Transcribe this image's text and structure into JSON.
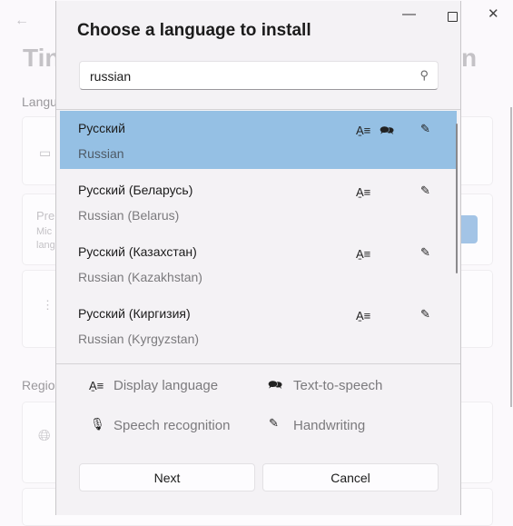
{
  "background": {
    "title_fragment_left": "Tin",
    "title_fragment_right": "n",
    "section_language_fragment": "Langu",
    "preferred_fragment_1": "Pre",
    "preferred_fragment_2": "Mic",
    "preferred_fragment_3": "lang",
    "section_region_fragment": "Regio"
  },
  "dialog": {
    "title": "Choose a language to install",
    "search": {
      "value": "russian",
      "placeholder": ""
    },
    "languages": [
      {
        "native": "Русский",
        "english": "Russian",
        "selected": true,
        "features": [
          "display-language",
          "text-to-speech",
          "handwriting"
        ]
      },
      {
        "native": "Русский (Беларусь)",
        "english": "Russian (Belarus)",
        "selected": false,
        "features": [
          "display-language",
          "handwriting"
        ]
      },
      {
        "native": "Русский (Казахстан)",
        "english": "Russian (Kazakhstan)",
        "selected": false,
        "features": [
          "display-language",
          "handwriting"
        ]
      },
      {
        "native": "Русский (Киргизия)",
        "english": "Russian (Kyrgyzstan)",
        "selected": false,
        "features": [
          "display-language",
          "handwriting"
        ]
      }
    ],
    "legend": {
      "display_language": "Display language",
      "text_to_speech": "Text-to-speech",
      "speech_recognition": "Speech recognition",
      "handwriting": "Handwriting"
    },
    "next_label": "Next",
    "cancel_label": "Cancel"
  },
  "colors": {
    "selected_row": "#95c0e4",
    "dialog_bg": "#f4f2f5"
  }
}
